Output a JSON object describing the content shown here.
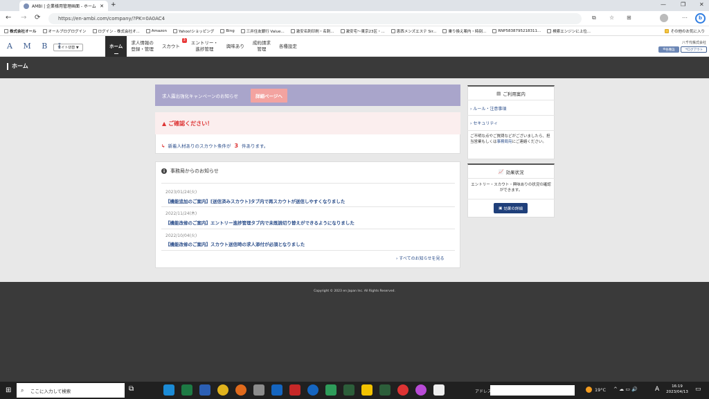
{
  "browser": {
    "tab_title": "AMBI | 企業様用管理画面 - ホーム",
    "url": "https://en-ambi.com/company/?PK=0A0AC4",
    "bookmarks": [
      "株式会社オール",
      "オールブログログイン",
      "ログイン - 株式会社オ...",
      "Amazon",
      "Yahoo!ショッピング",
      "Bing",
      "三井住友銀行 Value...",
      "激安名刺印刷・名刺...",
      "激安宅〜東京23区・...",
      "恵西メンズエステ Sir...",
      "乗り換え案内・時刻...",
      "RNP5838795218311...",
      "検索エンジンに上位..."
    ],
    "bookmark_folder": "その他のお気に入り"
  },
  "app": {
    "logo": "A M B I",
    "site_switch": "サイト切替 ▼",
    "nav": [
      {
        "label": "ホーム"
      },
      {
        "label": "求人情報の\n登録・管理"
      },
      {
        "label": "スカウト"
      },
      {
        "label": "エントリー・\n進捗管理"
      },
      {
        "label": "興味あり"
      },
      {
        "label": "成約請求\n管理"
      },
      {
        "label": "各種設定"
      }
    ],
    "scout_badge": "3",
    "company": "八千代株式会社",
    "settings_btn": "各種設",
    "logout_btn": "ログアウト"
  },
  "page": {
    "title": "ホーム",
    "campaign_text": "求人露出強化キャンペーンのお知らせ",
    "campaign_btn": "詳細ページへ",
    "confirm_title": "ご確認ください！",
    "scout_prefix": "新着人材ありのスカウト条件が",
    "scout_count": "3",
    "scout_suffix": "件あります。",
    "news_title": "事務局からのお知らせ",
    "news": [
      {
        "date": "2023/01/24(火)",
        "text": "【機能追加のご案内】[送信済みスカウト]タブ内で再スカウトが送信しやすくなりました"
      },
      {
        "date": "2022/11/24(木)",
        "text": "【機能改修のご案内】エントリー進捗管理タブ内で未既読切り替えができるようになりました"
      },
      {
        "date": "2022/10/04(火)",
        "text": "【機能改修のご案内】スカウト送信時の求人添付が必須となりました"
      }
    ],
    "all_news": "すべてのお知らせを見る",
    "guide_title": "ご利用案内",
    "guide_links": [
      "ルール・注意事項",
      "セキュリティ"
    ],
    "guide_note_a": "ご不明な点やご質問などがございましたら、担当営業もしくは",
    "guide_note_link": "事務局宛",
    "guide_note_b": "にご連絡ください。",
    "effect_title": "効果状況",
    "effect_note": "エントリー・スカウト・興味ありの状況の確認ができます。",
    "effect_btn": "効果の詳細",
    "copyright": "Copyright © 2023 en Japan Inc. All Rights Reserved."
  },
  "taskbar": {
    "search_placeholder": "ここに入力して検索",
    "address_label": "アドレス",
    "temperature": "19°C",
    "ime": "A",
    "time": "16:19",
    "date": "2023/04/13"
  }
}
